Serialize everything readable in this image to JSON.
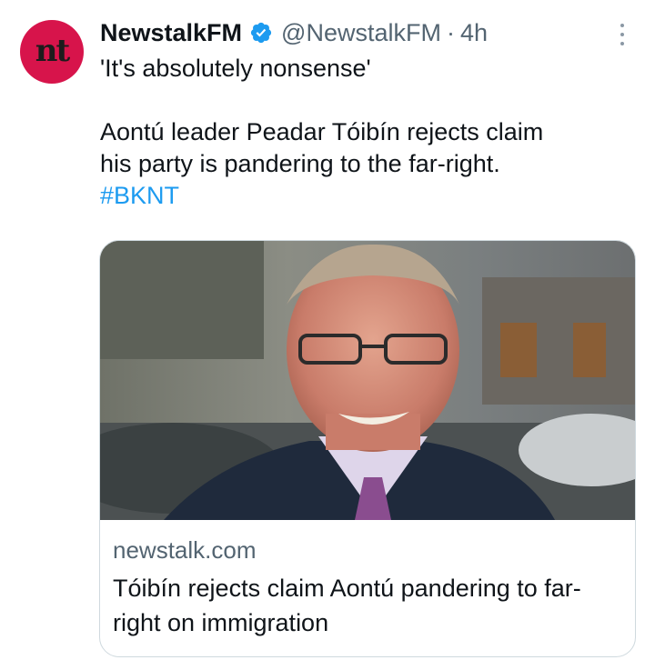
{
  "tweet": {
    "avatar_text": "nt",
    "display_name": "NewstalkFM",
    "handle": "@NewstalkFM",
    "separator": "·",
    "time": "4h",
    "line1": "'It's absolutely nonsense'",
    "line2": "Aontú leader Peadar Tóibín rejects claim",
    "line3": "his party is pandering to the far-right.",
    "hashtag": "#BKNT"
  },
  "card": {
    "domain": "newstalk.com",
    "title": "Tóibín rejects claim Aontú pandering to far-right on immigration"
  },
  "icons": {
    "verified": "verified-badge-icon",
    "more": "more-options-icon"
  },
  "colors": {
    "brand": "#d7144b",
    "link": "#1d9bf0",
    "verified": "#1d9bf0"
  }
}
